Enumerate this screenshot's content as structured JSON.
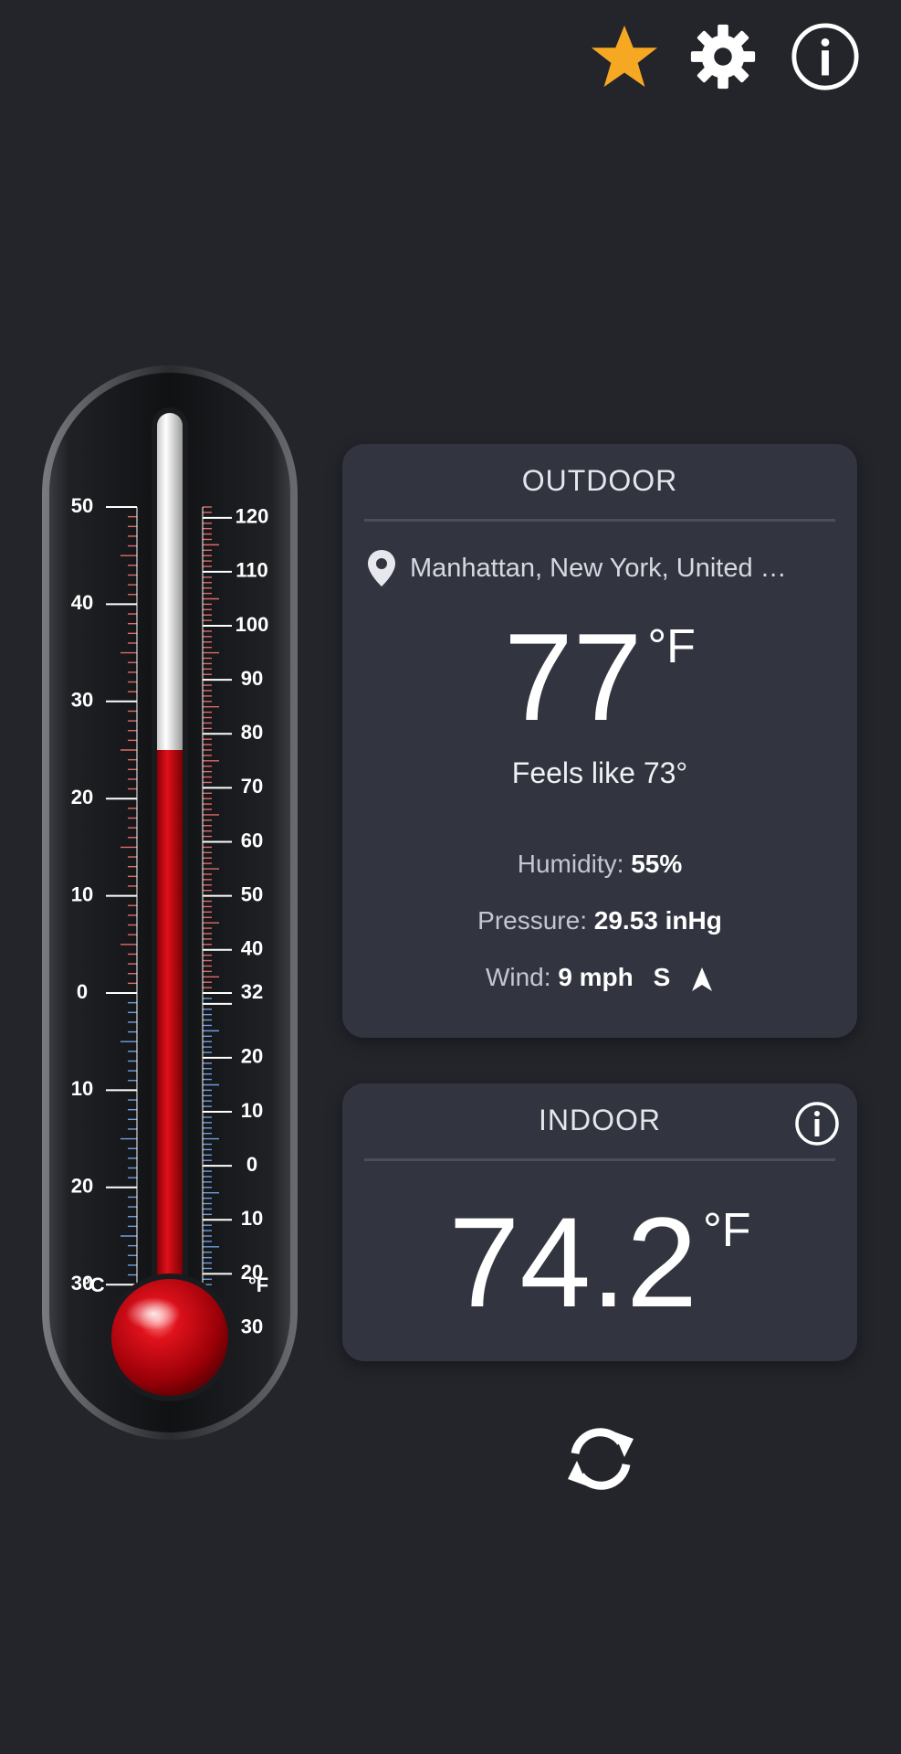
{
  "toolbar": {
    "icons": [
      "star-icon",
      "gear-icon",
      "info-icon"
    ],
    "star_color": "#f7a823"
  },
  "thermometer": {
    "celsius_ticks": [
      "50",
      "40",
      "30",
      "20",
      "10",
      "0",
      "10",
      "20",
      "30"
    ],
    "fahrenheit_ticks": [
      "120",
      "110",
      "100",
      "90",
      "80",
      "70",
      "60",
      "50",
      "40",
      "32",
      "20",
      "10",
      "0",
      "10",
      "20",
      "30"
    ],
    "celsius_unit": "°C",
    "fahrenheit_unit": "°F",
    "mercury_level_f": 77,
    "mercury_color": "#c8000a",
    "scale_warm_color": "#e06a6a",
    "scale_cold_color": "#6f9fe0"
  },
  "outdoor": {
    "title": "OUTDOOR",
    "location": "Manhattan, New York, United …",
    "temperature": "77",
    "unit": "°F",
    "feels_like": "Feels like 73°",
    "humidity_label": "Humidity:",
    "humidity_value": "55%",
    "pressure_label": "Pressure:",
    "pressure_value": "29.53 inHg",
    "wind_label": "Wind:",
    "wind_value": "9 mph",
    "wind_direction": "S"
  },
  "indoor": {
    "title": "INDOOR",
    "temperature": "74.2",
    "unit": "°F"
  },
  "actions": {
    "refresh_icon": "refresh-icon"
  }
}
